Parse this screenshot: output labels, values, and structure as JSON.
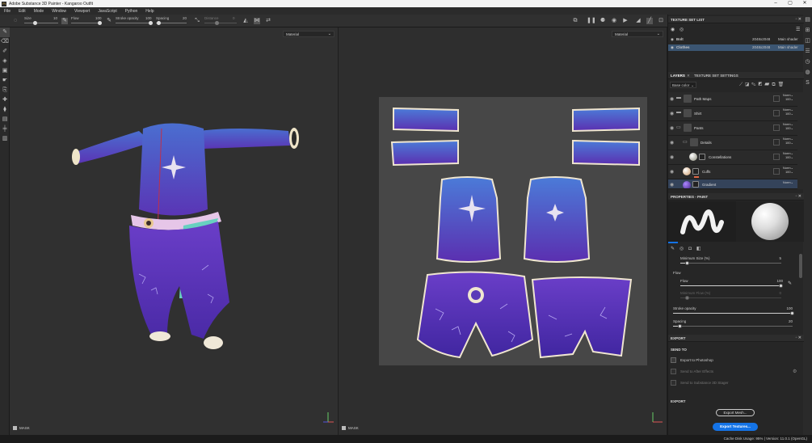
{
  "app": {
    "title": "Adobe Substance 3D Painter - Kangaroo Outfit"
  },
  "menu": [
    "File",
    "Edit",
    "Mode",
    "Window",
    "Viewport",
    "JavaScript",
    "Python",
    "Help"
  ],
  "toolbar": {
    "size_label": "Size",
    "size_value": "10",
    "flow_label": "Flow",
    "flow_value": "100",
    "stroke_opacity_label": "Stroke opacity",
    "stroke_opacity_value": "100",
    "spacing_label": "Spacing",
    "spacing_value": "20",
    "distance_label": "Distance",
    "distance_value": "0"
  },
  "viewport3d": {
    "material_dropdown": "Material",
    "mask_label": "MASK"
  },
  "viewport2d": {
    "material_dropdown": "Material",
    "mask_label": "MASK"
  },
  "texture_set_list": {
    "title": "TEXTURE SET LIST",
    "rows": [
      {
        "name": "Bolt",
        "resolution": "2048x2048",
        "shader": "Main shader"
      },
      {
        "name": "Clothes",
        "resolution": "2048x2048",
        "shader": "Main shader"
      }
    ]
  },
  "layers": {
    "tab_layers": "LAYERS",
    "tab_settings": "TEXTURE SET SETTINGS",
    "channel_dropdown": "Base color",
    "rows": [
      {
        "name": "Path Maps",
        "blend": "Norm",
        "opacity": "100"
      },
      {
        "name": "Shirt",
        "blend": "Norm",
        "opacity": "100"
      },
      {
        "name": "Pants",
        "blend": "Norm",
        "opacity": "100"
      },
      {
        "name": "Details",
        "blend": "Norm",
        "opacity": "100"
      },
      {
        "name": "Constellations",
        "blend": "Norm",
        "opacity": "100"
      },
      {
        "name": "Cuffs",
        "blend": "Norm",
        "opacity": "100"
      },
      {
        "name": "Gradient",
        "blend": "Norm",
        "opacity": ""
      }
    ]
  },
  "properties": {
    "title": "PROPERTIES - PAINT",
    "min_size_label": "Minimum Size (%)",
    "min_size_value": "5",
    "flow_section": "Flow",
    "flow_label": "Flow",
    "flow_value": "100",
    "min_flow_label": "Minimum Flow (%)",
    "min_flow_value": "0",
    "stroke_opacity_label": "Stroke opacity",
    "stroke_opacity_value": "100",
    "spacing_label": "Spacing",
    "spacing_value": "20"
  },
  "export": {
    "title": "EXPORT",
    "send_to_label": "SEND TO",
    "photoshop": "Export to Photoshop",
    "after_effects": "Send to After Effects",
    "stager": "Send to Substance 3D Stager",
    "export_label": "EXPORT",
    "export_mesh_button": "Export Mesh...",
    "export_textures_button": "Export Textures..."
  },
  "status": {
    "text": "Cache Disk Usage:   95% | Version: 11.0.1 (OpenGL)"
  },
  "colors": {
    "accent": "#1473e6",
    "purple": "#5a32b4",
    "blue": "#4e7bd6"
  }
}
